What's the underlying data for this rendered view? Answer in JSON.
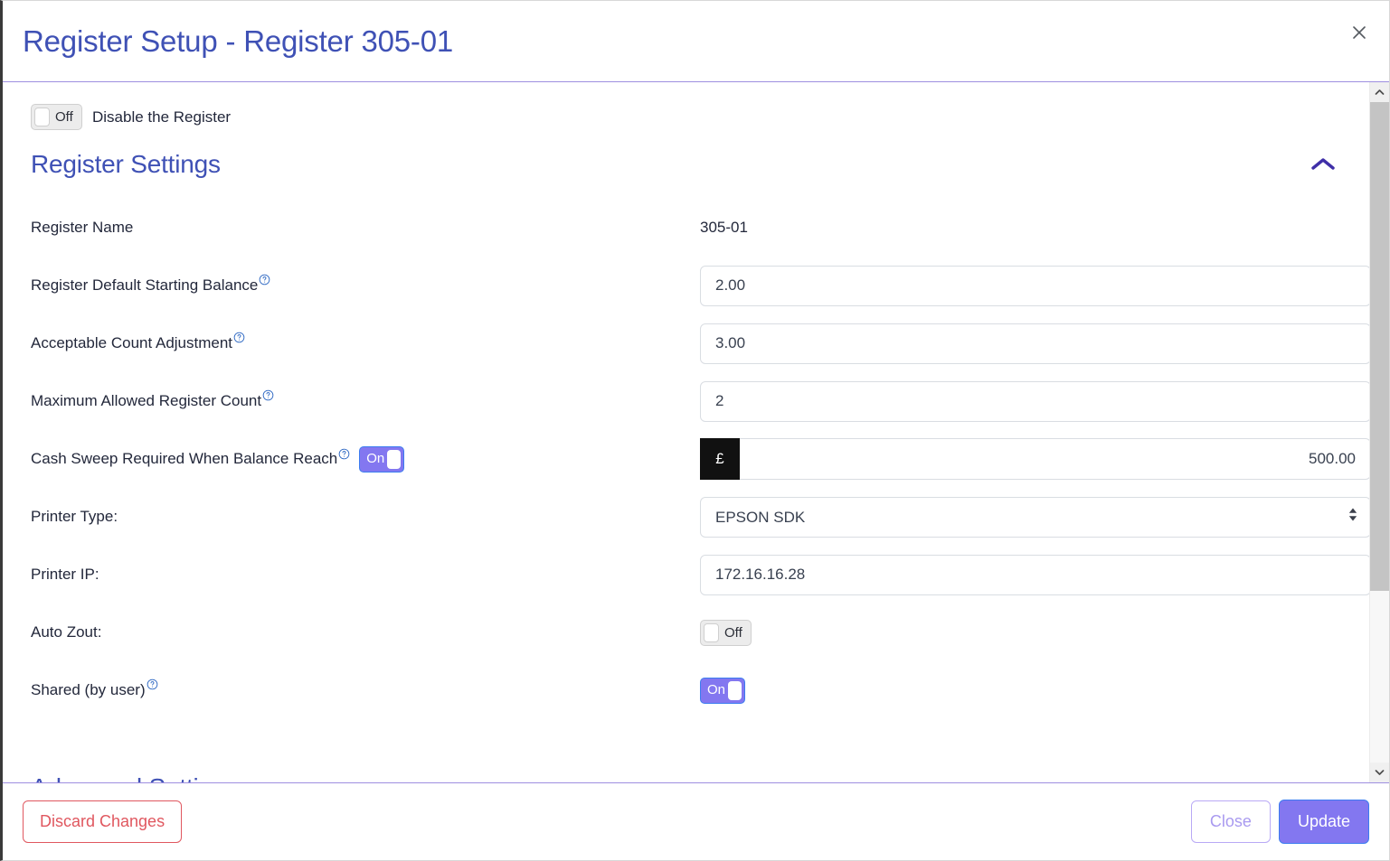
{
  "header": {
    "title": "Register Setup - Register 305-01",
    "close_icon": "close-icon"
  },
  "disable_register": {
    "toggle_state": "Off",
    "label": "Disable the Register"
  },
  "sections": {
    "register_settings": {
      "title": "Register Settings",
      "chevron": "chevron-up-icon",
      "expanded": true
    },
    "advanced_settings": {
      "title": "Advanced Settings",
      "chevron": "chevron-down-icon",
      "expanded": false
    }
  },
  "fields": {
    "register_name": {
      "label": "Register Name",
      "value": "305-01"
    },
    "default_starting_balance": {
      "label": "Register Default Starting Balance",
      "help": "help-icon",
      "value": "2.00"
    },
    "acceptable_count_adjustment": {
      "label": "Acceptable Count Adjustment",
      "help": "help-icon",
      "value": "3.00"
    },
    "maximum_allowed_register_count": {
      "label": "Maximum Allowed Register Count",
      "help": "help-icon",
      "value": "2"
    },
    "cash_sweep": {
      "label": "Cash Sweep Required When Balance Reach",
      "help": "help-icon",
      "toggle_state": "On",
      "currency_symbol": "£",
      "value": "500.00"
    },
    "printer_type": {
      "label": "Printer Type:",
      "value": "EPSON SDK",
      "options": [
        "EPSON SDK"
      ]
    },
    "printer_ip": {
      "label": "Printer IP:",
      "value": "172.16.16.28"
    },
    "auto_zout": {
      "label": "Auto Zout:",
      "toggle_state": "Off"
    },
    "shared_by_user": {
      "label": "Shared (by user)",
      "help": "help-icon",
      "toggle_state": "On"
    }
  },
  "footer": {
    "discard_label": "Discard Changes",
    "close_label": "Close",
    "update_label": "Update"
  },
  "colors": {
    "accent_indigo": "#3f51b5",
    "toggle_on": "#8377f0",
    "danger": "#e0575f",
    "primary_button": "#8377f0"
  }
}
